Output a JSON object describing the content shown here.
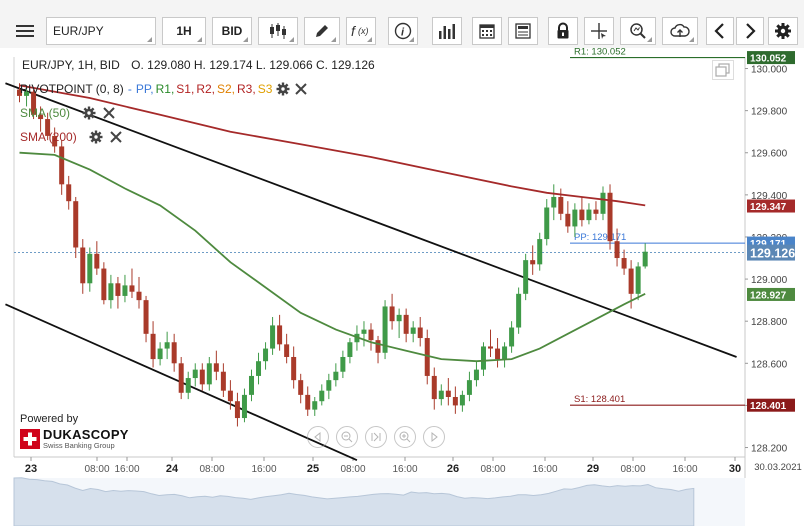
{
  "toolbar": {
    "instrument": "EUR/JPY",
    "timeframe": "1H",
    "price_side": "BID"
  },
  "header": {
    "title": "EUR/JPY, 1H, BID",
    "ohlc": "O. 129.080 H. 129.174 L. 129.066 C. 129.126"
  },
  "indicators": {
    "pivot": {
      "name": "PIVOTPOINT (0, 8)",
      "sep": "-",
      "levels": [
        "PP",
        "R1",
        "S1",
        "R2",
        "S2",
        "R3",
        "S3"
      ],
      "level_colors": [
        "#3a78d8",
        "#2a8a2a",
        "#b22222",
        "#b22222",
        "#e08000",
        "#b22222",
        "#e0a000"
      ]
    },
    "sma50": {
      "name": "SMA (50)",
      "color": "#4e8a3f"
    },
    "sma200": {
      "name": "SMA (200)",
      "color": "#a52a2a"
    }
  },
  "branding": {
    "powered_by": "Powered by",
    "logo": "DUKASCOPY",
    "tagline": "Swiss Banking Group"
  },
  "price_labels": {
    "r1": "R1: 130.052",
    "pp": "PP: 129.171",
    "s1": "S1: 128.401",
    "r1_value": "130.052",
    "sma200_value": "129.347",
    "pp_value": "129.171",
    "last_value": "129.126",
    "sma50_value": "128.927",
    "s1_value": "128.401"
  },
  "colors": {
    "bull": "#3f9a48",
    "bear": "#a93a2a",
    "trendline": "#111111",
    "sma50": "#4e8a3f",
    "sma200": "#a52a2a",
    "r1": "#2a6e2a",
    "s1": "#8b1a1a",
    "pp": "#3a78d8"
  },
  "chart_data": {
    "type": "candlestick",
    "instrument": "EUR/JPY",
    "timeframe": "1H",
    "ylim": [
      128.2,
      130.05
    ],
    "y_ticks": [
      "130.000",
      "129.800",
      "129.600",
      "129.400",
      "129.200",
      "129.000",
      "128.800",
      "128.600",
      "128.400",
      "128.200"
    ],
    "x_ticks": [
      {
        "label": "23",
        "bold": true
      },
      {
        "label": "08:00"
      },
      {
        "label": "16:00"
      },
      {
        "label": "24",
        "bold": true
      },
      {
        "label": "08:00"
      },
      {
        "label": "16:00"
      },
      {
        "label": "25",
        "bold": true
      },
      {
        "label": "08:00"
      },
      {
        "label": "16:00"
      },
      {
        "label": "26",
        "bold": true
      },
      {
        "label": "08:00"
      },
      {
        "label": "16:00"
      },
      {
        "label": "29",
        "bold": true
      },
      {
        "label": "08:00"
      },
      {
        "label": "16:00"
      },
      {
        "label": "30",
        "bold": true
      }
    ],
    "date_label": "30.03.2021",
    "levels": {
      "R1": 130.052,
      "PP": 129.171,
      "S1": 128.401
    },
    "last_price": 129.126,
    "sma50_last": 128.927,
    "sma200_last": 129.347,
    "candles": [
      [
        129.9,
        129.93,
        129.84,
        129.87
      ],
      [
        129.87,
        129.92,
        129.82,
        129.89
      ],
      [
        129.89,
        129.9,
        129.76,
        129.78
      ],
      [
        129.78,
        129.82,
        129.7,
        129.76
      ],
      [
        129.76,
        129.79,
        129.66,
        129.68
      ],
      [
        129.68,
        129.72,
        129.6,
        129.63
      ],
      [
        129.63,
        129.66,
        129.4,
        129.45
      ],
      [
        129.45,
        129.49,
        129.33,
        129.37
      ],
      [
        129.37,
        129.39,
        129.1,
        129.15
      ],
      [
        129.15,
        129.19,
        128.93,
        128.98
      ],
      [
        128.98,
        129.15,
        128.94,
        129.12
      ],
      [
        129.12,
        129.18,
        129.02,
        129.05
      ],
      [
        129.05,
        129.08,
        128.88,
        128.9
      ],
      [
        128.9,
        129.02,
        128.86,
        128.98
      ],
      [
        128.98,
        129.01,
        128.86,
        128.92
      ],
      [
        128.92,
        129.02,
        128.89,
        128.97
      ],
      [
        128.97,
        129.05,
        128.91,
        128.94
      ],
      [
        128.94,
        129.01,
        128.86,
        128.9
      ],
      [
        128.9,
        128.92,
        128.7,
        128.74
      ],
      [
        128.74,
        128.8,
        128.58,
        128.62
      ],
      [
        128.62,
        128.7,
        128.59,
        128.67
      ],
      [
        128.67,
        128.75,
        128.62,
        128.7
      ],
      [
        128.7,
        128.74,
        128.56,
        128.6
      ],
      [
        128.6,
        128.63,
        128.43,
        128.46
      ],
      [
        128.46,
        128.56,
        128.43,
        128.53
      ],
      [
        128.53,
        128.6,
        128.49,
        128.57
      ],
      [
        128.57,
        128.6,
        128.47,
        128.5
      ],
      [
        128.5,
        128.63,
        128.47,
        128.6
      ],
      [
        128.6,
        128.66,
        128.52,
        128.56
      ],
      [
        128.56,
        128.6,
        128.44,
        128.47
      ],
      [
        128.47,
        128.52,
        128.38,
        128.42
      ],
      [
        128.42,
        128.46,
        128.3,
        128.34
      ],
      [
        128.34,
        128.48,
        128.32,
        128.45
      ],
      [
        128.45,
        128.57,
        128.42,
        128.54
      ],
      [
        128.54,
        128.65,
        128.5,
        128.61
      ],
      [
        128.61,
        128.7,
        128.57,
        128.67
      ],
      [
        128.67,
        128.82,
        128.64,
        128.78
      ],
      [
        128.78,
        128.83,
        128.66,
        128.69
      ],
      [
        128.69,
        128.74,
        128.6,
        128.63
      ],
      [
        128.63,
        128.68,
        128.48,
        128.52
      ],
      [
        128.52,
        128.55,
        128.41,
        128.45
      ],
      [
        128.45,
        128.49,
        128.35,
        128.38
      ],
      [
        128.38,
        128.44,
        128.35,
        128.42
      ],
      [
        128.42,
        128.5,
        128.4,
        128.47
      ],
      [
        128.47,
        128.55,
        128.43,
        128.52
      ],
      [
        128.52,
        128.6,
        128.49,
        128.56
      ],
      [
        128.56,
        128.66,
        128.53,
        128.63
      ],
      [
        128.63,
        128.72,
        128.6,
        128.7
      ],
      [
        128.7,
        128.78,
        128.66,
        128.74
      ],
      [
        128.74,
        128.8,
        128.68,
        128.76
      ],
      [
        128.76,
        128.79,
        128.66,
        128.71
      ],
      [
        128.71,
        128.73,
        128.6,
        128.65
      ],
      [
        128.65,
        128.9,
        128.62,
        128.87
      ],
      [
        128.87,
        128.93,
        128.76,
        128.8
      ],
      [
        128.8,
        128.86,
        128.72,
        128.83
      ],
      [
        128.83,
        128.86,
        128.7,
        128.74
      ],
      [
        128.74,
        128.8,
        128.7,
        128.77
      ],
      [
        128.77,
        128.82,
        128.68,
        128.72
      ],
      [
        128.72,
        128.76,
        128.5,
        128.54
      ],
      [
        128.54,
        128.58,
        128.38,
        128.43
      ],
      [
        128.43,
        128.5,
        128.4,
        128.47
      ],
      [
        128.47,
        128.53,
        128.4,
        128.44
      ],
      [
        128.44,
        128.49,
        128.36,
        128.4
      ],
      [
        128.4,
        128.47,
        128.37,
        128.45
      ],
      [
        128.45,
        128.56,
        128.42,
        128.52
      ],
      [
        128.52,
        128.61,
        128.49,
        128.57
      ],
      [
        128.57,
        128.7,
        128.54,
        128.68
      ],
      [
        128.68,
        128.76,
        128.63,
        128.67
      ],
      [
        128.67,
        128.72,
        128.58,
        128.62
      ],
      [
        128.62,
        128.7,
        128.58,
        128.68
      ],
      [
        128.68,
        128.8,
        128.65,
        128.77
      ],
      [
        128.77,
        128.96,
        128.74,
        128.93
      ],
      [
        128.93,
        129.12,
        128.9,
        129.09
      ],
      [
        129.09,
        129.16,
        129.02,
        129.07
      ],
      [
        129.07,
        129.22,
        129.04,
        129.19
      ],
      [
        129.19,
        129.38,
        129.16,
        129.34
      ],
      [
        129.34,
        129.45,
        129.28,
        129.39
      ],
      [
        129.39,
        129.43,
        129.28,
        129.31
      ],
      [
        129.31,
        129.37,
        129.22,
        129.25
      ],
      [
        129.25,
        129.36,
        129.2,
        129.33
      ],
      [
        129.33,
        129.39,
        129.25,
        129.28
      ],
      [
        129.28,
        129.36,
        129.26,
        129.33
      ],
      [
        129.33,
        129.37,
        129.28,
        129.31
      ],
      [
        129.31,
        129.44,
        129.28,
        129.41
      ],
      [
        129.41,
        129.45,
        129.14,
        129.18
      ],
      [
        129.18,
        129.24,
        129.06,
        129.1
      ],
      [
        129.1,
        129.14,
        129.02,
        129.05
      ],
      [
        129.05,
        129.09,
        128.86,
        128.93
      ],
      [
        128.93,
        129.08,
        128.9,
        129.06
      ],
      [
        129.06,
        129.17,
        129.05,
        129.13
      ]
    ],
    "sma50": [
      [
        0,
        129.6
      ],
      [
        5,
        129.59
      ],
      [
        10,
        129.52
      ],
      [
        15,
        129.43
      ],
      [
        20,
        129.35
      ],
      [
        25,
        129.23
      ],
      [
        30,
        129.08
      ],
      [
        35,
        128.96
      ],
      [
        40,
        128.84
      ],
      [
        45,
        128.76
      ],
      [
        50,
        128.7
      ],
      [
        55,
        128.66
      ],
      [
        60,
        128.62
      ],
      [
        65,
        128.61
      ],
      [
        70,
        128.62
      ],
      [
        74,
        128.67
      ],
      [
        78,
        128.74
      ],
      [
        82,
        128.81
      ],
      [
        86,
        128.88
      ],
      [
        89,
        128.93
      ]
    ],
    "sma200": [
      [
        0,
        129.92
      ],
      [
        10,
        129.86
      ],
      [
        20,
        129.78
      ],
      [
        30,
        129.7
      ],
      [
        40,
        129.64
      ],
      [
        50,
        129.58
      ],
      [
        60,
        129.51
      ],
      [
        70,
        129.44
      ],
      [
        75,
        129.41
      ],
      [
        80,
        129.39
      ],
      [
        85,
        129.37
      ],
      [
        89,
        129.35
      ]
    ],
    "trendlines": [
      {
        "x0": -2,
        "y0": 129.93,
        "x1": 102,
        "y1": 128.63
      },
      {
        "x0": -2,
        "y0": 128.88,
        "x1": 48,
        "y1": 128.14
      }
    ]
  }
}
